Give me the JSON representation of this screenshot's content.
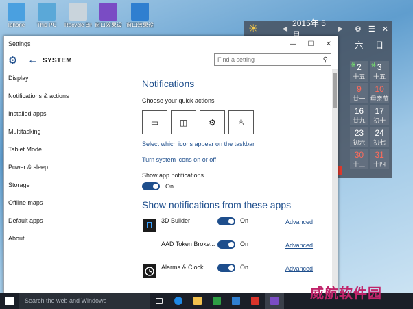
{
  "desktop": {
    "icons": [
      {
        "label": "Iphone",
        "icon": "user-folder-icon",
        "color": "#4aa0e0"
      },
      {
        "label": "This PC",
        "icon": "computer-icon",
        "color": "#5aa8d8"
      },
      {
        "label": "Recycle Bin",
        "icon": "recycle-bin-icon",
        "color": "#c9d4dc"
      },
      {
        "label": "窗口效果设置",
        "icon": "app-shortcut-icon",
        "color": "#7a4cc4"
      },
      {
        "label": "窗口效果设置",
        "icon": "app-shortcut-icon",
        "color": "#2f7fd0"
      }
    ]
  },
  "calendar": {
    "title": "2015年 5月",
    "weekday_headers": [
      "六",
      "日"
    ],
    "rows": [
      [
        {
          "day": "2",
          "lunar": "十五",
          "tag": "休",
          "red": false
        },
        {
          "day": "3",
          "lunar": "十五",
          "tag": "休",
          "red": false
        }
      ],
      [
        {
          "day": "9",
          "lunar": "廿一",
          "red": true
        },
        {
          "day": "10",
          "lunar": "母亲节",
          "red": true
        }
      ],
      [
        {
          "day": "16",
          "lunar": "廿九",
          "red": false
        },
        {
          "day": "17",
          "lunar": "初十",
          "red": false
        }
      ],
      [
        {
          "day": "23",
          "lunar": "初六",
          "red": false
        },
        {
          "day": "24",
          "lunar": "初七",
          "red": false
        }
      ],
      [
        {
          "day": "30",
          "lunar": "十三",
          "red": true
        },
        {
          "day": "31",
          "lunar": "十四",
          "red": true
        }
      ]
    ]
  },
  "window": {
    "title": "Settings",
    "controls": [
      "—",
      "☐",
      "✕"
    ],
    "section": "SYSTEM",
    "search_placeholder": "Find a setting"
  },
  "nav": [
    "Display",
    "Notifications & actions",
    "Installed apps",
    "Multitasking",
    "Tablet Mode",
    "Power & sleep",
    "Storage",
    "Offline maps",
    "Default apps",
    "About"
  ],
  "content": {
    "heading": "Notifications",
    "quick_actions_label": "Choose your quick actions",
    "quick_actions": [
      {
        "icon": "tablet-mode-icon"
      },
      {
        "icon": "project-icon"
      },
      {
        "icon": "settings-gear-icon"
      },
      {
        "icon": "connect-user-icon"
      }
    ],
    "link_taskbar": "Select which icons appear on the taskbar",
    "link_system_icons": "Turn system icons on or off",
    "show_app_notifications_label": "Show app notifications",
    "show_app_notifications_state": "On",
    "apps_heading": "Show notifications from these apps",
    "apps": [
      {
        "name": "3D Builder",
        "state": "On",
        "advanced": "Advanced",
        "icon": "3d-builder-icon",
        "color": "#1b1b1b"
      },
      {
        "name": "AAD Token Broke...",
        "state": "On",
        "advanced": "Advanced",
        "icon": "token-broker-icon",
        "color": "#ffffff"
      },
      {
        "name": "Alarms & Clock",
        "state": "On",
        "advanced": "Advanced",
        "icon": "alarm-clock-icon",
        "color": "#1b1b1b"
      }
    ]
  },
  "taskbar": {
    "search_placeholder": "Search the web and Windows",
    "buttons": [
      {
        "icon": "task-view-icon",
        "color": "#e8e8e8"
      },
      {
        "icon": "edge-browser-icon",
        "color": "#1e88e5"
      },
      {
        "icon": "file-explorer-icon",
        "color": "#f2c14e"
      },
      {
        "icon": "store-icon",
        "color": "#2e9e44"
      },
      {
        "icon": "outlook-icon",
        "color": "#2f7fd0"
      },
      {
        "icon": "red-app-icon",
        "color": "#d9342b"
      },
      {
        "icon": "purple-settings-icon",
        "color": "#7a4cc4"
      }
    ]
  },
  "watermark": "威航软件园"
}
